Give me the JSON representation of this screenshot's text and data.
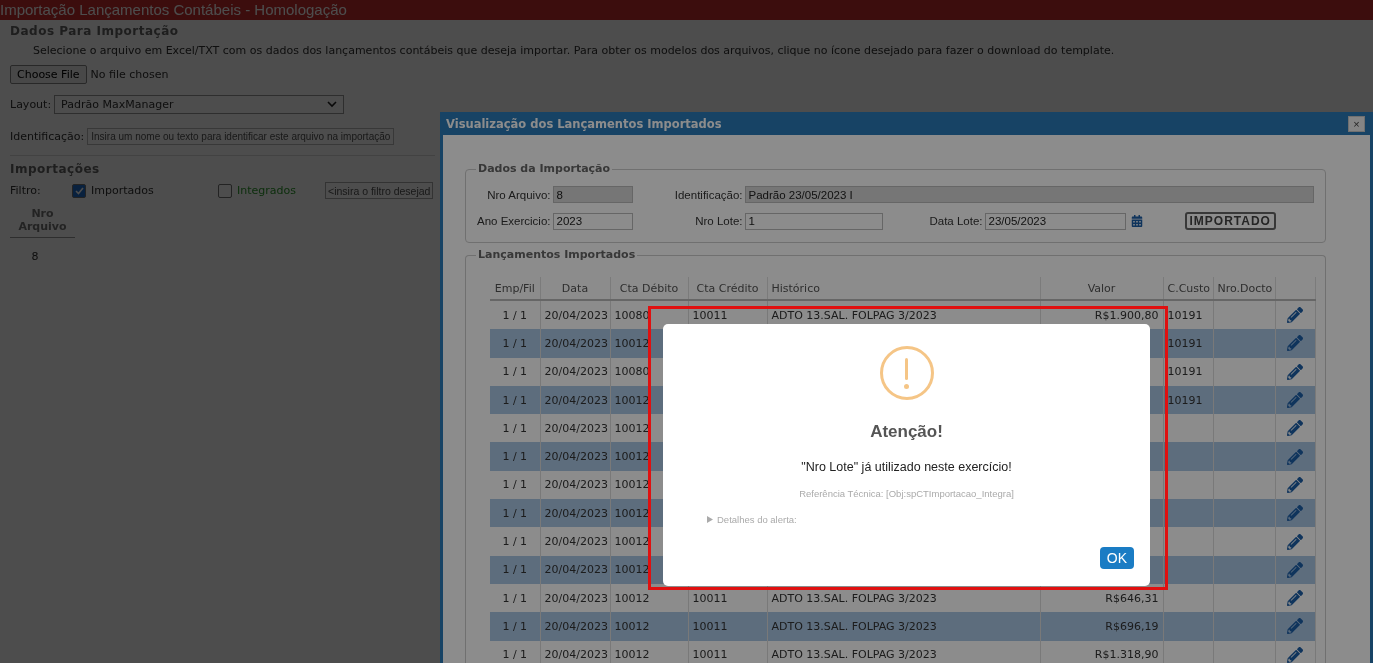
{
  "page": {
    "title": "Importação Lançamentos Contábeis  - Homologação"
  },
  "upload": {
    "legend": "Dados Para Importação",
    "instructions": "Selecione o arquivo em Excel/TXT com os dados dos lançamentos contábeis que deseja importar. Para obter os modelos dos arquivos, clique no ícone desejado para fazer o download do template.",
    "file_button": "Choose File",
    "file_status": "No file chosen",
    "layout_label": "Layout:",
    "layout_value": "Padrão MaxManager",
    "identification_label": "Identificação:",
    "identification_placeholder": "Insira um nome ou texto para identificar este arquivo na importação"
  },
  "imports": {
    "legend": "Importações",
    "filter_label": "Filtro:",
    "filters": [
      {
        "label": "Importados",
        "checked": true
      },
      {
        "label": "Integrados",
        "checked": false
      }
    ],
    "filter_placeholder": "<insira o filtro desejad",
    "columns": [
      "Nro Arquivo"
    ],
    "rows": [
      [
        "8"
      ]
    ]
  },
  "modal": {
    "title": "Visualização dos Lançamentos Importados",
    "close": "×",
    "import_data": {
      "legend": "Dados da Importação",
      "fields": [
        {
          "label": "Nro Arquivo:",
          "value": "8",
          "readonly": true
        },
        {
          "label": "Identificação:",
          "value": "Padrão 23/05/2023 I",
          "readonly": true
        },
        {
          "label": "Ano Exercicio:",
          "value": "2023",
          "readonly": false
        },
        {
          "label": "Nro Lote:",
          "value": "1",
          "readonly": false
        },
        {
          "label": "Data Lote:",
          "value": "23/05/2023",
          "readonly": false
        }
      ],
      "status": "IMPORTADO"
    },
    "entries": {
      "legend": "Lançamentos Importados",
      "columns": [
        "Emp/Fil",
        "Data",
        "Cta Débito",
        "Cta Crédito",
        "Histórico",
        "Valor",
        "C.Custo",
        "Nro.Docto"
      ],
      "rows": [
        {
          "emp": "1 / 1",
          "date": "20/04/2023",
          "debit": "10080",
          "credit": "10011",
          "history": "ADTO 13.SAL. FOLPAG 3/2023",
          "value": "R$1.900,80",
          "cost": "10191"
        },
        {
          "emp": "1 / 1",
          "date": "20/04/2023",
          "debit": "10012",
          "cost": "10191"
        },
        {
          "emp": "1 / 1",
          "date": "20/04/2023",
          "debit": "10080",
          "cost": "10191"
        },
        {
          "emp": "1 / 1",
          "date": "20/04/2023",
          "debit": "10012",
          "cost": "10191"
        },
        {
          "emp": "1 / 1",
          "date": "20/04/2023",
          "debit": "10012"
        },
        {
          "emp": "1 / 1",
          "date": "20/04/2023",
          "debit": "10012"
        },
        {
          "emp": "1 / 1",
          "date": "20/04/2023",
          "debit": "10012"
        },
        {
          "emp": "1 / 1",
          "date": "20/04/2023",
          "debit": "10012"
        },
        {
          "emp": "1 / 1",
          "date": "20/04/2023",
          "debit": "10012"
        },
        {
          "emp": "1 / 1",
          "date": "20/04/2023",
          "debit": "10012"
        },
        {
          "emp": "1 / 1",
          "date": "20/04/2023",
          "debit": "10012",
          "credit": "10011",
          "history": "ADTO 13.SAL. FOLPAG 3/2023",
          "value": "R$646,31"
        },
        {
          "emp": "1 / 1",
          "date": "20/04/2023",
          "debit": "10012",
          "credit": "10011",
          "history": "ADTO 13.SAL. FOLPAG 3/2023",
          "value": "R$696,19"
        },
        {
          "emp": "1 / 1",
          "date": "20/04/2023",
          "debit": "10012",
          "credit": "10011",
          "history": "ADTO 13.SAL. FOLPAG 3/2023",
          "value": "R$1.318,90"
        }
      ]
    }
  },
  "alert": {
    "title": "Atenção!",
    "message": "\"Nro Lote\" já utilizado neste exercício!",
    "reference": "Referência Técnica: [Obj:spCTImportacao_Integra]",
    "details": "Detalhes do alerta:",
    "ok": "OK"
  }
}
